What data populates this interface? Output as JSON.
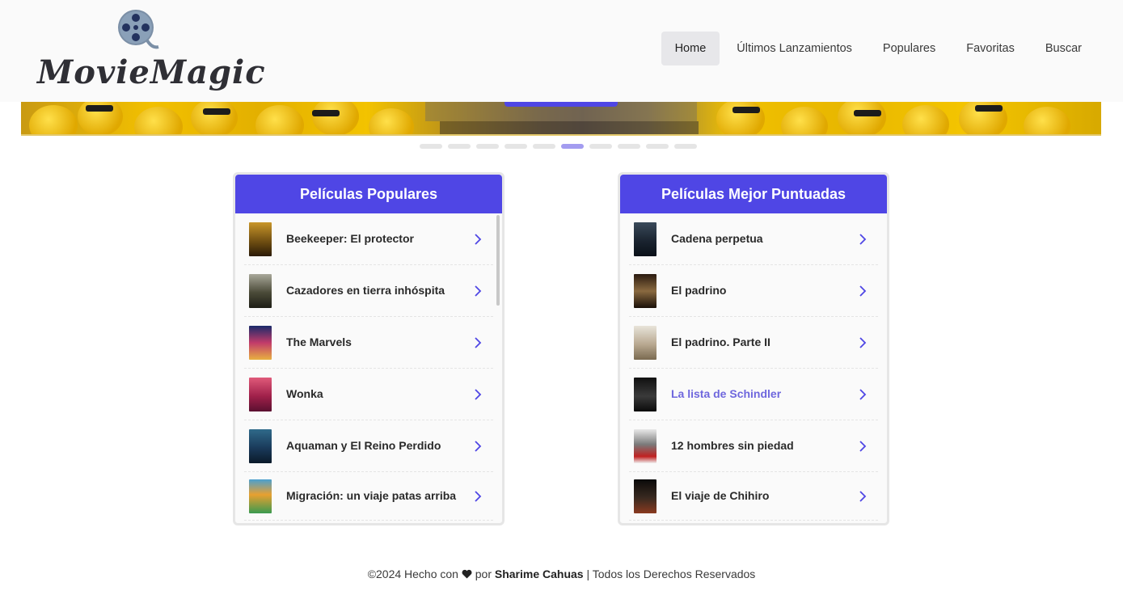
{
  "brand": {
    "name": "MovieMagic"
  },
  "nav": [
    {
      "label": "Home",
      "active": true
    },
    {
      "label": "Últimos Lanzamientos",
      "active": false
    },
    {
      "label": "Populares",
      "active": false
    },
    {
      "label": "Favoritas",
      "active": false
    },
    {
      "label": "Buscar",
      "active": false
    }
  ],
  "carousel": {
    "slide_count": 10,
    "active_index": 5
  },
  "popular": {
    "title": "Películas Populares",
    "items": [
      {
        "title": "Beekeeper: El protector"
      },
      {
        "title": "Cazadores en tierra inhóspita"
      },
      {
        "title": "The Marvels"
      },
      {
        "title": "Wonka"
      },
      {
        "title": "Aquaman y El Reino Perdido"
      },
      {
        "title": "Migración: un viaje patas arriba"
      }
    ]
  },
  "top_rated": {
    "title": "Películas Mejor Puntuadas",
    "items": [
      {
        "title": "Cadena perpetua"
      },
      {
        "title": "El padrino"
      },
      {
        "title": "El padrino. Parte II"
      },
      {
        "title": "La lista de Schindler"
      },
      {
        "title": "12 hombres sin piedad"
      },
      {
        "title": "El viaje de Chihiro"
      }
    ]
  },
  "footer": {
    "prefix": "©2024 Hecho con",
    "by": "por",
    "author": "Sharime Cahuas",
    "suffix": "| Todos los Derechos Reservados"
  },
  "colors": {
    "accent": "#4f46e5",
    "hover_link": "#6f67dd",
    "dot_active": "#a39cf0"
  }
}
